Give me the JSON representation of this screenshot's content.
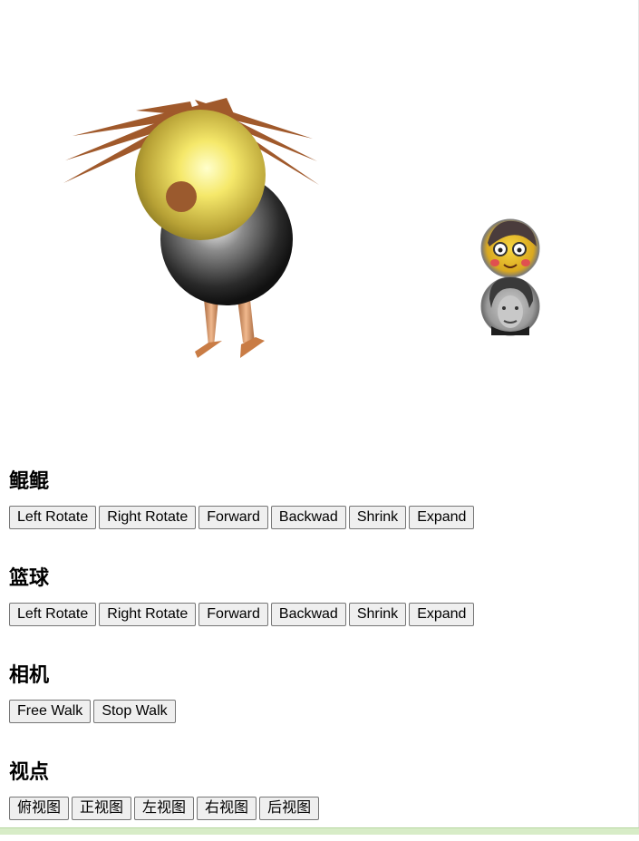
{
  "sections": [
    {
      "title": "鲲鲲",
      "buttons": [
        "Left Rotate",
        "Right Rotate",
        "Forward",
        "Backwad",
        "Shrink",
        "Expand"
      ]
    },
    {
      "title": "篮球",
      "buttons": [
        "Left Rotate",
        "Right Rotate",
        "Forward",
        "Backwad",
        "Shrink",
        "Expand"
      ]
    },
    {
      "title": "相机",
      "buttons": [
        "Free Walk",
        "Stop Walk"
      ]
    },
    {
      "title": "视点",
      "buttons": [
        "俯视图",
        "正视图",
        "左视图",
        "右视图",
        "后视图"
      ]
    }
  ],
  "colors": {
    "hair": "#a0592b",
    "head": "#d9c54a",
    "body": "#2b2b2b",
    "legs": "#d59465",
    "ball_face_top": "#f0c020",
    "ball_face_bottom": "#9a9a9a"
  }
}
